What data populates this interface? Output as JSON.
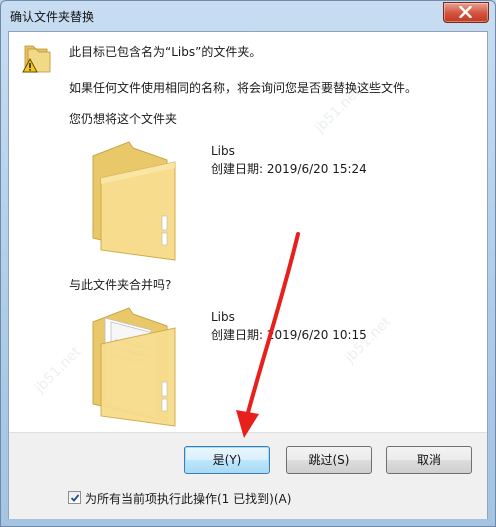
{
  "window": {
    "title": "确认文件夹替换"
  },
  "message": {
    "line1": "此目标已包含名为“Libs”的文件夹。",
    "line2": "如果任何文件使用相同的名称，将会询问您是否要替换这些文件。",
    "line3": "您仍想将这个文件夹",
    "line4": "与此文件夹合并吗?"
  },
  "target_folder": {
    "name": "Libs",
    "created": "创建日期: 2019/6/20 15:24"
  },
  "source_folder": {
    "name": "Libs",
    "created": "创建日期: 2019/6/20 10:15"
  },
  "buttons": {
    "yes": "是(Y)",
    "skip": "跳过(S)",
    "cancel": "取消"
  },
  "checkbox": {
    "label": "为所有当前项执行此操作(1 已找到)(A)",
    "checked": true
  },
  "colors": {
    "folder": "#f0d27a",
    "arrow": "#e8201c",
    "close": "#c8452c"
  }
}
